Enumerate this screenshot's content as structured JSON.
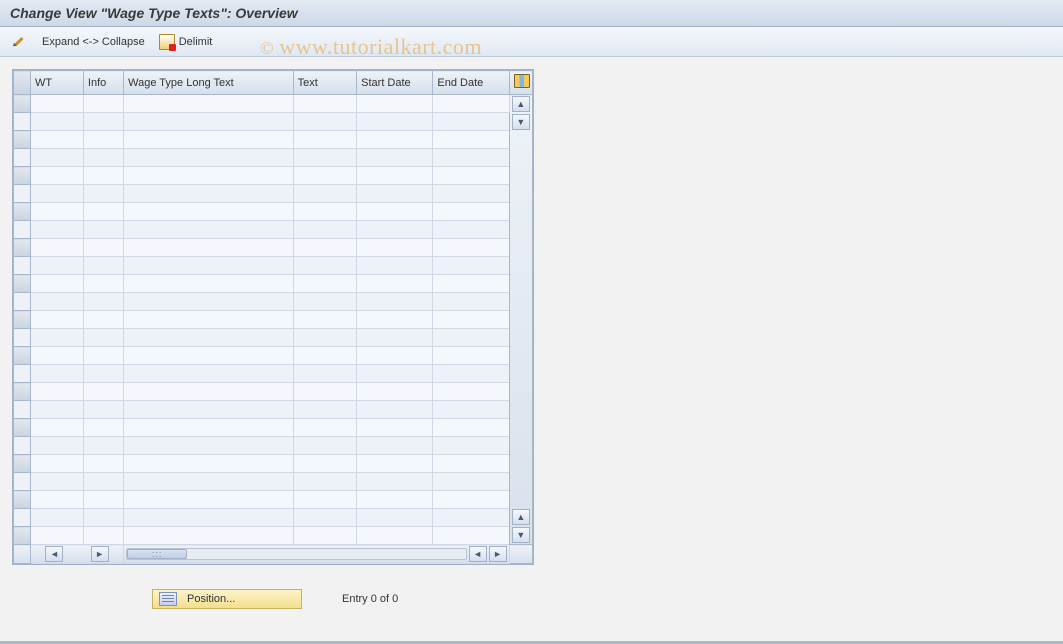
{
  "title": "Change View \"Wage Type Texts\": Overview",
  "toolbar": {
    "expand_collapse_label": "Expand <-> Collapse",
    "delimit_label": "Delimit"
  },
  "watermark": "www.tutorialkart.com",
  "table": {
    "columns": [
      "WT",
      "Info",
      "Wage Type Long Text",
      "Text",
      "Start Date",
      "End Date"
    ],
    "row_count": 25
  },
  "footer": {
    "position_label": "Position...",
    "entry_label": "Entry 0 of 0"
  }
}
